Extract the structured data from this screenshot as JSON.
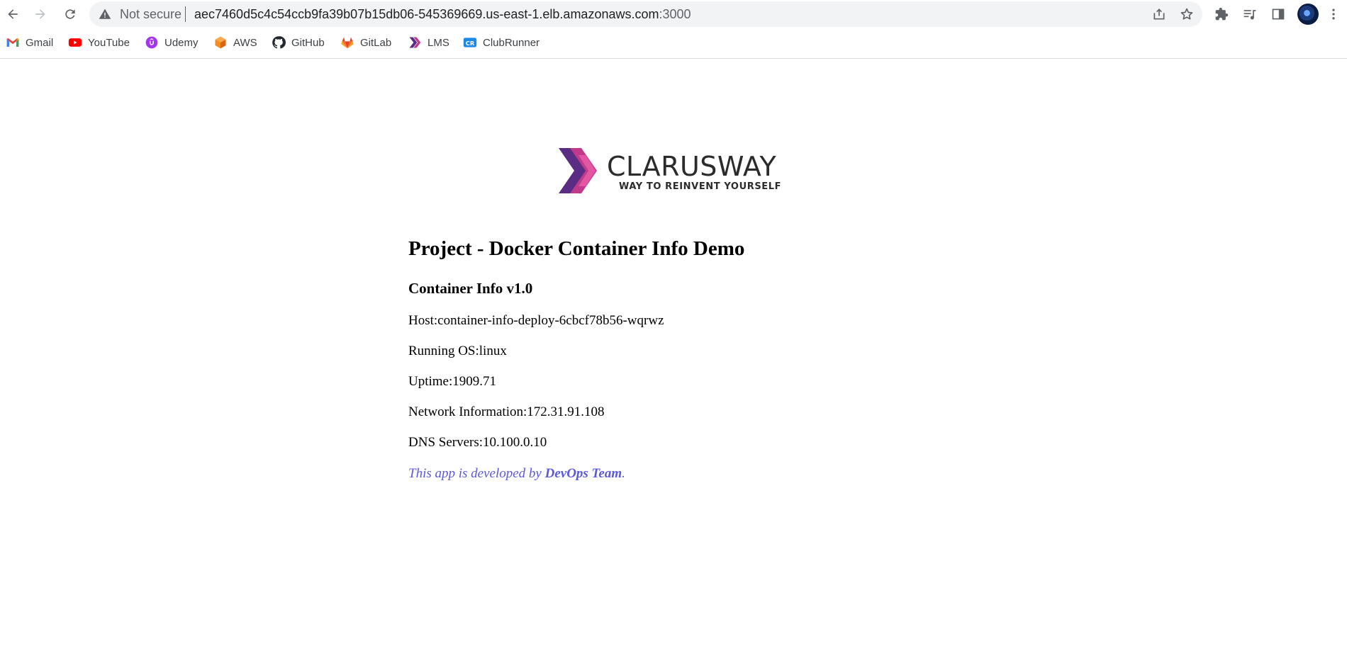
{
  "browser": {
    "security_label": "Not secure",
    "url_host": "aec7460d5c4c54ccb9fa39b07b15db06-545369669.us-east-1.elb.amazonaws.com",
    "url_port": ":3000",
    "icons": [
      "back-arrow-icon",
      "forward-arrow-icon",
      "reload-icon",
      "warning-icon",
      "share-icon",
      "star-icon",
      "extensions-icon",
      "reading-list-icon",
      "side-panel-icon",
      "profile-avatar",
      "more-vert-icon"
    ]
  },
  "bookmarks": [
    {
      "label": "Gmail",
      "icon": "gmail-icon",
      "color": "#EA4335"
    },
    {
      "label": "YouTube",
      "icon": "youtube-icon",
      "color": "#FF0000"
    },
    {
      "label": "Udemy",
      "icon": "udemy-icon",
      "color": "#A435F0"
    },
    {
      "label": "AWS",
      "icon": "aws-icon",
      "color": "#F68B1F"
    },
    {
      "label": "GitHub",
      "icon": "github-icon",
      "color": "#24292F"
    },
    {
      "label": "GitLab",
      "icon": "gitlab-icon",
      "color": "#E24329"
    },
    {
      "label": "LMS",
      "icon": "lms-icon",
      "color": "#8E3C9E"
    },
    {
      "label": "ClubRunner",
      "icon": "clubrunner-icon",
      "color": "#1E88E5"
    }
  ],
  "logo": {
    "name": "CLARUSWAY",
    "tagline": "WAY TO REINVENT YOURSELF",
    "colors": [
      "#5B2C83",
      "#C0398A",
      "#E85DA8"
    ]
  },
  "page": {
    "title": "Project - Docker Container Info Demo",
    "subtitle": "Container Info v1.0",
    "host": "Host:container-info-deploy-6cbcf78b56-wqrwz",
    "os": "Running OS:linux",
    "uptime": "Uptime:1909.71",
    "network": "Network Information:172.31.91.108",
    "dns": "DNS Servers:10.100.0.10",
    "footer_prefix": "This app is developed by ",
    "footer_team": "DevOps Team",
    "footer_suffix": ".",
    "accent_color": "#5A57E0"
  }
}
